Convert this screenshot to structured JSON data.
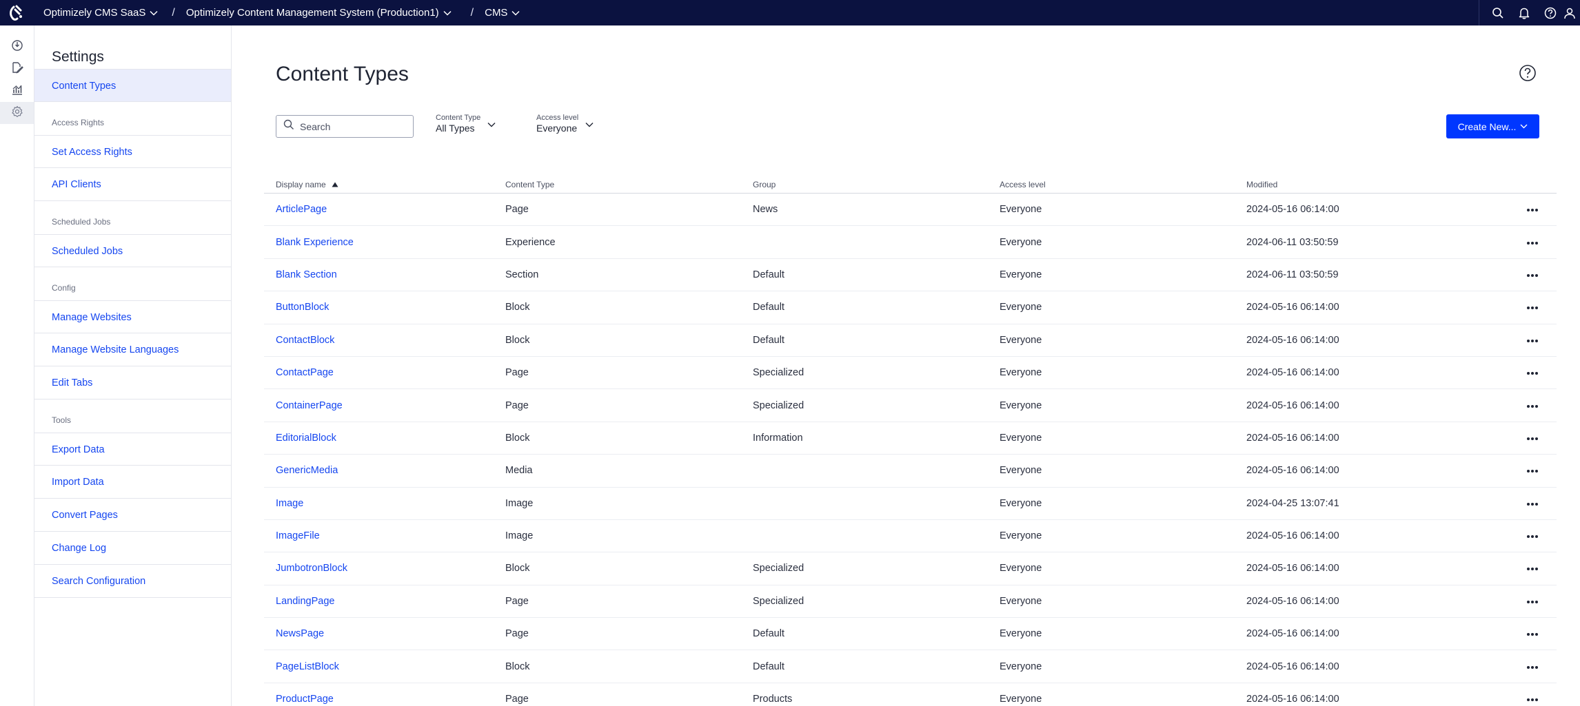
{
  "topbar": {
    "crumbs": [
      {
        "label": "Optimizely CMS SaaS"
      },
      {
        "label": "Optimizely Content Management System (Production1)"
      },
      {
        "label": "CMS"
      }
    ],
    "separator": "/"
  },
  "sidebar": {
    "title": "Settings",
    "content_types": "Content Types",
    "groups": {
      "access_rights": "Access Rights",
      "scheduled_jobs": "Scheduled Jobs",
      "config": "Config",
      "tools": "Tools"
    },
    "links": {
      "set_access_rights": "Set Access Rights",
      "api_clients": "API Clients",
      "scheduled_jobs": "Scheduled Jobs",
      "manage_websites": "Manage Websites",
      "manage_website_languages": "Manage Website Languages",
      "edit_tabs": "Edit Tabs",
      "export_data": "Export Data",
      "import_data": "Import Data",
      "convert_pages": "Convert Pages",
      "change_log": "Change Log",
      "search_configuration": "Search Configuration"
    }
  },
  "main": {
    "title": "Content Types",
    "search_placeholder": "Search",
    "filters": {
      "content_type": {
        "label": "Content Type",
        "value": "All Types"
      },
      "access_level": {
        "label": "Access level",
        "value": "Everyone"
      }
    },
    "create_button": "Create New..."
  },
  "table": {
    "headers": {
      "display_name": "Display name",
      "content_type": "Content Type",
      "group": "Group",
      "access_level": "Access level",
      "modified": "Modified"
    },
    "rows": [
      {
        "name": "ArticlePage",
        "type": "Page",
        "group": "News",
        "access": "Everyone",
        "modified": "2024-05-16 06:14:00"
      },
      {
        "name": "Blank Experience",
        "type": "Experience",
        "group": "",
        "access": "Everyone",
        "modified": "2024-06-11 03:50:59"
      },
      {
        "name": "Blank Section",
        "type": "Section",
        "group": "Default",
        "access": "Everyone",
        "modified": "2024-06-11 03:50:59"
      },
      {
        "name": "ButtonBlock",
        "type": "Block",
        "group": "Default",
        "access": "Everyone",
        "modified": "2024-05-16 06:14:00"
      },
      {
        "name": "ContactBlock",
        "type": "Block",
        "group": "Default",
        "access": "Everyone",
        "modified": "2024-05-16 06:14:00"
      },
      {
        "name": "ContactPage",
        "type": "Page",
        "group": "Specialized",
        "access": "Everyone",
        "modified": "2024-05-16 06:14:00"
      },
      {
        "name": "ContainerPage",
        "type": "Page",
        "group": "Specialized",
        "access": "Everyone",
        "modified": "2024-05-16 06:14:00"
      },
      {
        "name": "EditorialBlock",
        "type": "Block",
        "group": "Information",
        "access": "Everyone",
        "modified": "2024-05-16 06:14:00"
      },
      {
        "name": "GenericMedia",
        "type": "Media",
        "group": "",
        "access": "Everyone",
        "modified": "2024-05-16 06:14:00"
      },
      {
        "name": "Image",
        "type": "Image",
        "group": "",
        "access": "Everyone",
        "modified": "2024-04-25 13:07:41"
      },
      {
        "name": "ImageFile",
        "type": "Image",
        "group": "",
        "access": "Everyone",
        "modified": "2024-05-16 06:14:00"
      },
      {
        "name": "JumbotronBlock",
        "type": "Block",
        "group": "Specialized",
        "access": "Everyone",
        "modified": "2024-05-16 06:14:00"
      },
      {
        "name": "LandingPage",
        "type": "Page",
        "group": "Specialized",
        "access": "Everyone",
        "modified": "2024-05-16 06:14:00"
      },
      {
        "name": "NewsPage",
        "type": "Page",
        "group": "Default",
        "access": "Everyone",
        "modified": "2024-05-16 06:14:00"
      },
      {
        "name": "PageListBlock",
        "type": "Block",
        "group": "Default",
        "access": "Everyone",
        "modified": "2024-05-16 06:14:00"
      },
      {
        "name": "ProductPage",
        "type": "Page",
        "group": "Products",
        "access": "Everyone",
        "modified": "2024-05-16 06:14:00"
      }
    ]
  },
  "icons": {
    "brand_color": "#0b1240",
    "accent": "#0037ff",
    "link": "#1546f0"
  }
}
